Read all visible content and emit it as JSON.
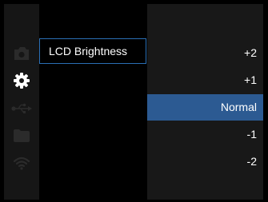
{
  "sidebar": {
    "icons": [
      {
        "name": "camera-icon",
        "active": false
      },
      {
        "name": "gear-icon",
        "active": true
      },
      {
        "name": "usb-icon",
        "active": false
      },
      {
        "name": "folder-icon",
        "active": false
      },
      {
        "name": "wifi-icon",
        "active": false
      }
    ]
  },
  "menu": {
    "selected_item": "LCD Brightness"
  },
  "options": {
    "items": [
      "+2",
      "+1",
      "Normal",
      "-1",
      "-2"
    ],
    "selected": "Normal"
  },
  "colors": {
    "accent": "#2c5a92",
    "menu_border": "#2a6fb5",
    "sidebar_bg": "#161616",
    "options_bg": "#181818",
    "icon_dim": "#2b2b2b",
    "icon_active": "#ffffff"
  }
}
